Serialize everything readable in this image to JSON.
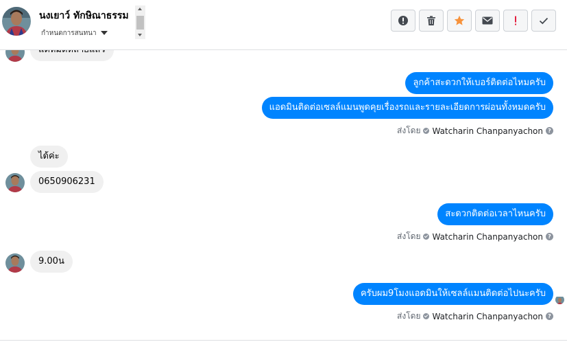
{
  "header": {
    "contact_name": "นงเยาว์ ทักษิณาธรรม",
    "stage_label": "กำหนดการสนทนา",
    "toolbar": [
      {
        "name": "spam-report-button",
        "icon": "exclamation-circle-icon",
        "color": "#444950"
      },
      {
        "name": "delete-button",
        "icon": "trash-icon",
        "color": "#444950"
      },
      {
        "name": "star-button",
        "icon": "star-icon",
        "color": "#f7923b"
      },
      {
        "name": "mark-unread-button",
        "icon": "envelope-icon",
        "color": "#444950"
      },
      {
        "name": "follow-up-button",
        "icon": "exclamation-icon",
        "color": "#e41e3f"
      },
      {
        "name": "done-button",
        "icon": "checkmark-icon",
        "color": "#444950"
      }
    ]
  },
  "messages": {
    "m0": "แต่หมดหลายแล้ว",
    "m1": "ลูกค้าสะดวกให้เบอร์ติดต่อไหมครับ",
    "m2": "แอดมินติดต่อเซลล์แมนพูดคุยเรื่องรถและรายละเอียดการผ่อนทั้งหมดครับ",
    "m3": "ได้ค่ะ",
    "m4": "0650906231",
    "m5": "สะดวกติดต่อเวลาไหนครับ",
    "m6": "9.00น",
    "m7": "ครับผม9โมงแอดมินให้เซลล์แมนติดต่อไปนะครับ"
  },
  "sent_by": {
    "prefix": "ส่งโดย",
    "agent": "Watcharin Chanpanyachon",
    "help": "?"
  },
  "colors": {
    "outgoing_bubble": "#0084ff",
    "incoming_bubble": "#f0f0f0"
  }
}
